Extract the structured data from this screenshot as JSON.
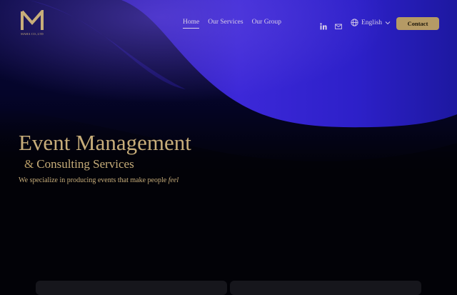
{
  "brand": {
    "logo_text": "MAHA CO.,LTD",
    "accent": "#c7ad7a"
  },
  "nav": {
    "items": [
      {
        "label": "Home",
        "active": true
      },
      {
        "label": "Our Services",
        "active": false
      },
      {
        "label": "Our Group",
        "active": false
      }
    ]
  },
  "social": {
    "linkedin_icon": "linkedin-icon",
    "mail_icon": "mail-icon"
  },
  "language": {
    "label": "English",
    "icon": "globe-icon"
  },
  "contact": {
    "label": "Contact",
    "color": "#b59a65"
  },
  "hero": {
    "title": "Event Management",
    "subtitle_amp": "&",
    "subtitle": "Consulting Services",
    "tagline_prefix": "We specialize in producing events that make people ",
    "tagline_emphasis": "feel"
  }
}
